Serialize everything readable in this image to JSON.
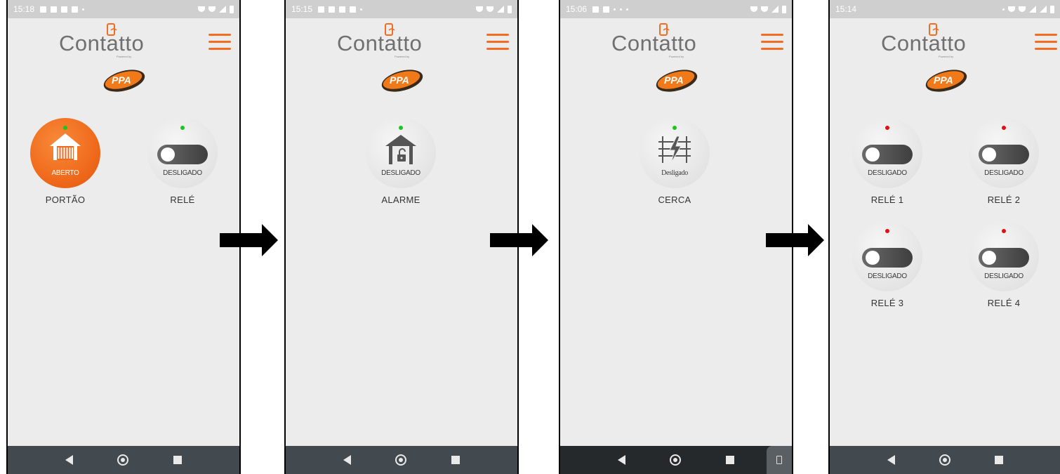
{
  "app": {
    "name": "Contatto",
    "tagline": "Powered by",
    "partner_logo": "PPA",
    "brand_color": "#f26d21",
    "led_on_color": "#1ec41e",
    "led_off_color": "#e01010"
  },
  "nav_bar": {
    "icons": [
      "back-icon",
      "home-icon",
      "recents-icon"
    ]
  },
  "screens": [
    {
      "status_time": "15:18",
      "tiles": [
        {
          "label": "PORTÃO",
          "state": "ABERTO",
          "icon": "gate-icon",
          "led": "green",
          "style": "active-orange"
        },
        {
          "label": "RELÉ",
          "state": "DESLIGADO",
          "icon": "toggle-switch",
          "led": "green",
          "style": "neutral"
        }
      ]
    },
    {
      "status_time": "15:15",
      "tiles": [
        {
          "label": "ALARME",
          "state": "DESLIGADO",
          "icon": "house-lock-icon",
          "led": "green",
          "style": "neutral"
        }
      ]
    },
    {
      "status_time": "15:06",
      "extra_button": "rotate-screen-icon",
      "tiles": [
        {
          "label": "CERCA",
          "state": "Desligado",
          "icon": "electric-fence-icon",
          "led": "green",
          "style": "neutral"
        }
      ]
    },
    {
      "status_time": "15:14",
      "tiles": [
        {
          "label": "RELÉ 1",
          "state": "DESLIGADO",
          "icon": "toggle-switch",
          "led": "red",
          "style": "neutral"
        },
        {
          "label": "RELÉ 2",
          "state": "DESLIGADO",
          "icon": "toggle-switch",
          "led": "red",
          "style": "neutral"
        },
        {
          "label": "RELÉ 3",
          "state": "DESLIGADO",
          "icon": "toggle-switch",
          "led": "red",
          "style": "neutral"
        },
        {
          "label": "RELÉ 4",
          "state": "DESLIGADO",
          "icon": "toggle-switch",
          "led": "red",
          "style": "neutral"
        }
      ]
    }
  ]
}
